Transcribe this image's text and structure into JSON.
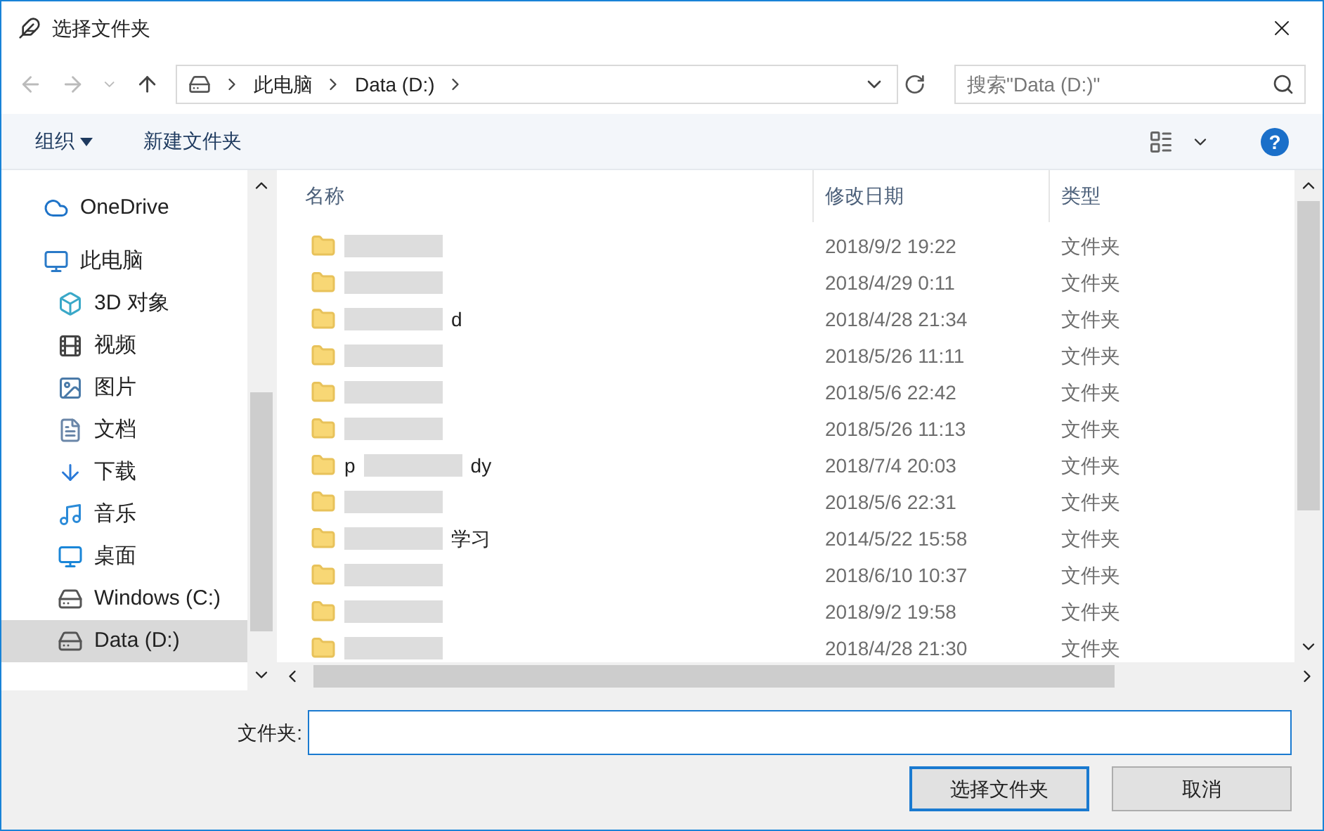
{
  "window": {
    "title": "选择文件夹"
  },
  "address": {
    "crumbs": [
      "此电脑",
      "Data (D:)"
    ]
  },
  "search": {
    "placeholder": "搜索\"Data (D:)\""
  },
  "toolbar": {
    "organize": "组织",
    "new_folder": "新建文件夹",
    "help": "?"
  },
  "sidebar": {
    "items": [
      {
        "label": "OneDrive",
        "selected": false
      },
      {
        "label": "此电脑",
        "selected": false,
        "children": [
          {
            "label": "3D 对象",
            "selected": false
          },
          {
            "label": "视频",
            "selected": false
          },
          {
            "label": "图片",
            "selected": false
          },
          {
            "label": "文档",
            "selected": false
          },
          {
            "label": "下载",
            "selected": false
          },
          {
            "label": "音乐",
            "selected": false
          },
          {
            "label": "桌面",
            "selected": false
          },
          {
            "label": "Windows (C:)",
            "selected": false
          },
          {
            "label": "Data (D:)",
            "selected": true
          }
        ]
      }
    ]
  },
  "table": {
    "columns": [
      "名称",
      "修改日期",
      "类型"
    ],
    "rows": [
      {
        "date": "2018/9/2 19:22",
        "type": "文件夹"
      },
      {
        "date": "2018/4/29 0:11",
        "type": "文件夹"
      },
      {
        "name_end": "d",
        "date": "2018/4/28 21:34",
        "type": "文件夹"
      },
      {
        "date": "2018/5/26 11:11",
        "type": "文件夹"
      },
      {
        "date": "2018/5/6 22:42",
        "type": "文件夹"
      },
      {
        "date": "2018/5/26 11:13",
        "type": "文件夹"
      },
      {
        "name_start": "p",
        "name_end": "dy",
        "date": "2018/7/4 20:03",
        "type": "文件夹"
      },
      {
        "date": "2018/5/6 22:31",
        "type": "文件夹"
      },
      {
        "name_end": "学习",
        "date": "2014/5/22 15:58",
        "type": "文件夹"
      },
      {
        "date": "2018/6/10 10:37",
        "type": "文件夹"
      },
      {
        "date": "2018/9/2 19:58",
        "type": "文件夹"
      },
      {
        "date": "2018/4/28 21:30",
        "type": "文件夹"
      }
    ]
  },
  "folder_field": {
    "label": "文件夹:"
  },
  "buttons": [
    "选择文件夹",
    "取消"
  ]
}
